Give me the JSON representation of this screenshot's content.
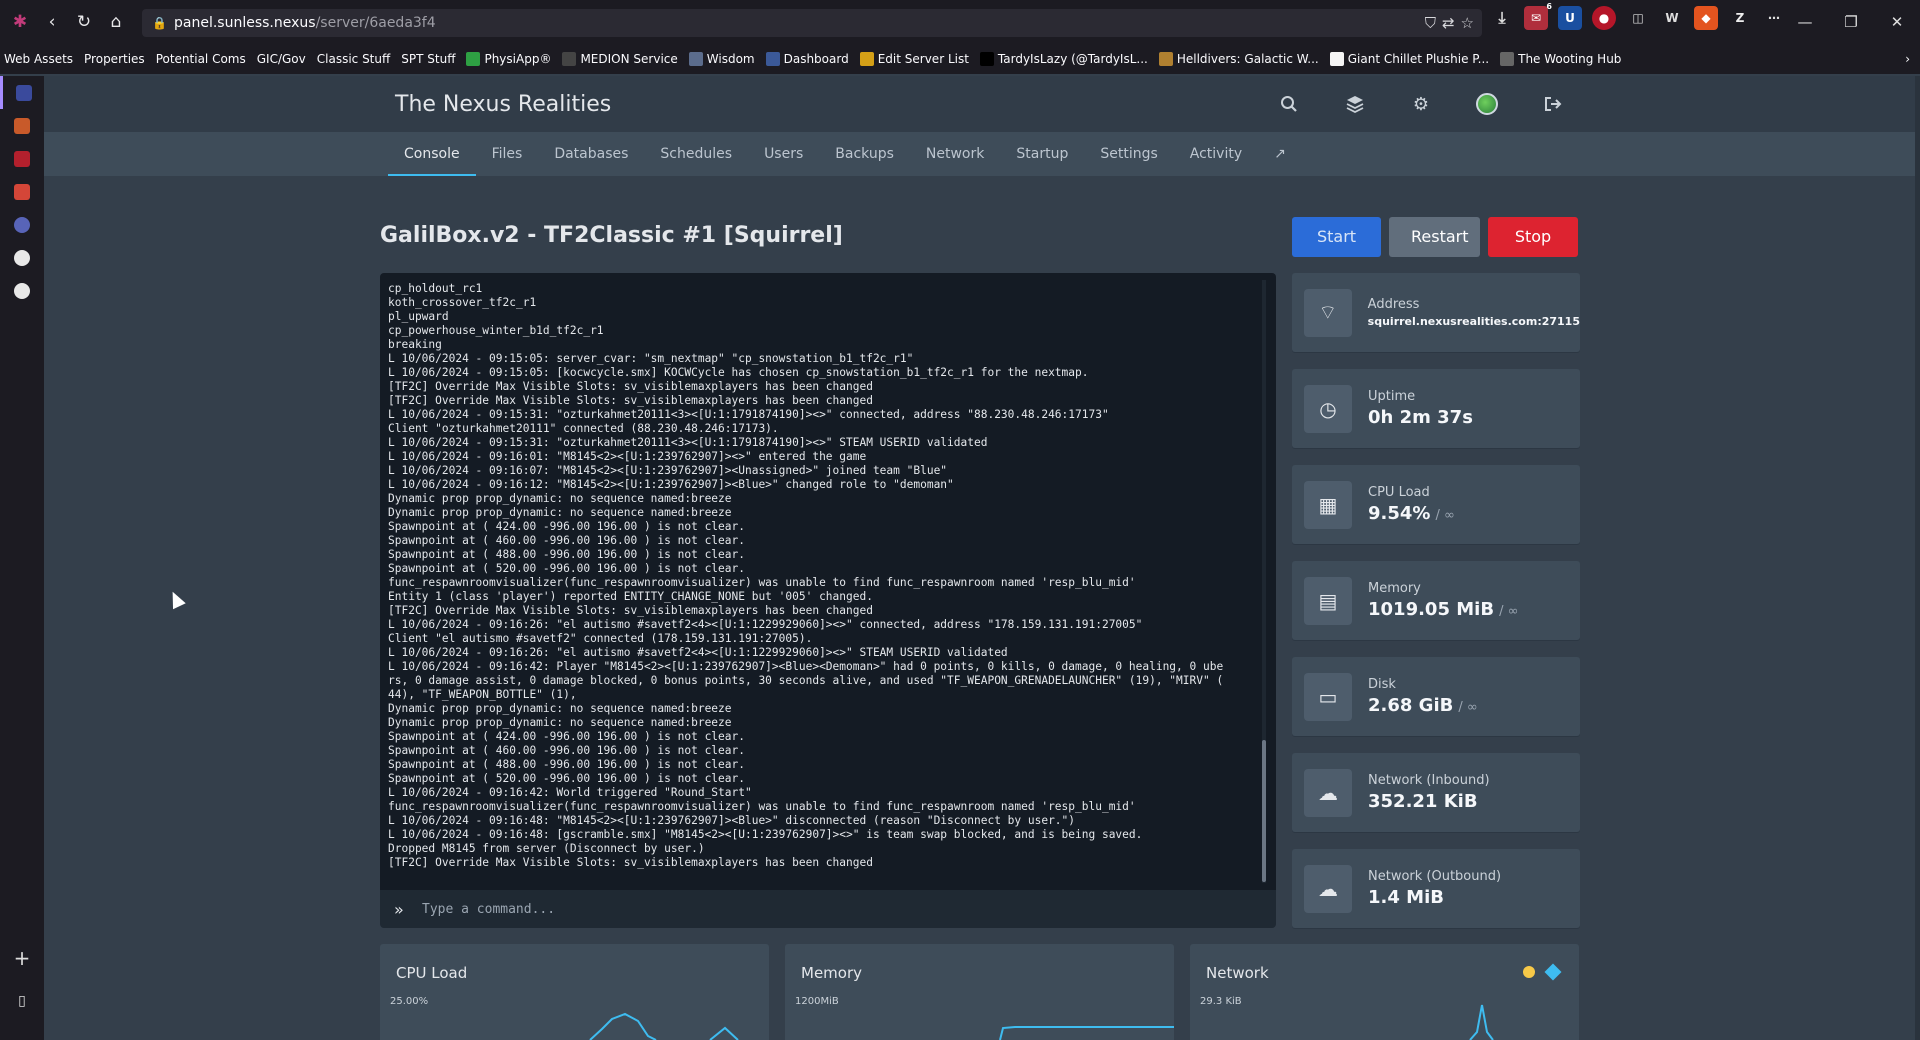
{
  "browser": {
    "url_host": "panel.sunless.nexus",
    "url_path": "/server/6aeda3f4",
    "bookmarks": [
      "Web Assets",
      "Properties",
      "Potential Coms",
      "GIC/Gov",
      "Classic Stuff",
      "SPT Stuff",
      "PhysiApp®",
      "MEDION Service",
      "Wisdom",
      "Dashboard",
      "Edit Server List",
      "TardyIsLazy (@TardyIsL...",
      "Helldivers: Galactic W...",
      "Giant Chillet Plushie P...",
      "The Wooting Hub"
    ],
    "download_badge": "6"
  },
  "panel": {
    "title": "The Nexus Realities",
    "tabs": [
      "Console",
      "Files",
      "Databases",
      "Schedules",
      "Users",
      "Backups",
      "Network",
      "Startup",
      "Settings",
      "Activity"
    ]
  },
  "server": {
    "name": "GalilBox.v2 - TF2Classic #1 [Squirrel]",
    "start_label": "Start",
    "restart_label": "Restart",
    "stop_label": "Stop"
  },
  "console": {
    "lines": [
      "cp_holdout_rc1",
      "koth_crossover_tf2c_r1",
      "pl_upward",
      "cp_powerhouse_winter_b1d_tf2c_r1",
      "breaking",
      "L 10/06/2024 - 09:15:05: server_cvar: \"sm_nextmap\" \"cp_snowstation_b1_tf2c_r1\"",
      "L 10/06/2024 - 09:15:05: [kocwcycle.smx] KOCWCycle has chosen cp_snowstation_b1_tf2c_r1 for the nextmap.",
      "[TF2C] Override Max Visible Slots: sv_visiblemaxplayers has been changed",
      "[TF2C] Override Max Visible Slots: sv_visiblemaxplayers has been changed",
      "L 10/06/2024 - 09:15:31: \"ozturkahmet20111<3><[U:1:1791874190]><>\" connected, address \"88.230.48.246:17173\"",
      "Client \"ozturkahmet20111\" connected (88.230.48.246:17173).",
      "L 10/06/2024 - 09:15:31: \"ozturkahmet20111<3><[U:1:1791874190]><>\" STEAM USERID validated",
      "L 10/06/2024 - 09:16:01: \"M8145<2><[U:1:239762907]><>\" entered the game",
      "L 10/06/2024 - 09:16:07: \"M8145<2><[U:1:239762907]><Unassigned>\" joined team \"Blue\"",
      "L 10/06/2024 - 09:16:12: \"M8145<2><[U:1:239762907]><Blue>\" changed role to \"demoman\"",
      "Dynamic prop prop_dynamic: no sequence named:breeze",
      "Dynamic prop prop_dynamic: no sequence named:breeze",
      "Spawnpoint at ( 424.00 -996.00 196.00 ) is not clear.",
      "Spawnpoint at ( 460.00 -996.00 196.00 ) is not clear.",
      "Spawnpoint at ( 488.00 -996.00 196.00 ) is not clear.",
      "Spawnpoint at ( 520.00 -996.00 196.00 ) is not clear.",
      "func_respawnroomvisualizer(func_respawnroomvisualizer) was unable to find func_respawnroom named 'resp_blu_mid'",
      "Entity 1 (class 'player') reported ENTITY_CHANGE_NONE but '005' changed.",
      "[TF2C] Override Max Visible Slots: sv_visiblemaxplayers has been changed",
      "L 10/06/2024 - 09:16:26: \"el autismo #savetf2<4><[U:1:1229929060]><>\" connected, address \"178.159.131.191:27005\"",
      "Client \"el autismo #savetf2\" connected (178.159.131.191:27005).",
      "L 10/06/2024 - 09:16:26: \"el autismo #savetf2<4><[U:1:1229929060]><>\" STEAM USERID validated",
      "L 10/06/2024 - 09:16:42: Player \"M8145<2><[U:1:239762907]><Blue><Demoman>\" had 0 points, 0 kills, 0 damage, 0 healing, 0 ube",
      "rs, 0 damage assist, 0 damage blocked, 0 bonus points, 30 seconds alive, and used \"TF_WEAPON_GRENADELAUNCHER\" (19), \"MIRV\" (",
      "44), \"TF_WEAPON_BOTTLE\" (1),",
      "Dynamic prop prop_dynamic: no sequence named:breeze",
      "Dynamic prop prop_dynamic: no sequence named:breeze",
      "Spawnpoint at ( 424.00 -996.00 196.00 ) is not clear.",
      "Spawnpoint at ( 460.00 -996.00 196.00 ) is not clear.",
      "Spawnpoint at ( 488.00 -996.00 196.00 ) is not clear.",
      "Spawnpoint at ( 520.00 -996.00 196.00 ) is not clear.",
      "L 10/06/2024 - 09:16:42: World triggered \"Round_Start\"",
      "func_respawnroomvisualizer(func_respawnroomvisualizer) was unable to find func_respawnroom named 'resp_blu_mid'",
      "L 10/06/2024 - 09:16:48: \"M8145<2><[U:1:239762907]><Blue>\" disconnected (reason \"Disconnect by user.\")",
      "L 10/06/2024 - 09:16:48: [gscramble.smx] \"M8145<2><[U:1:239762907]><>\" is team swap blocked, and is being saved.",
      "Dropped M8145 from server (Disconnect by user.)",
      "[TF2C] Override Max Visible Slots: sv_visiblemaxplayers has been changed"
    ],
    "command_placeholder": "Type a command..."
  },
  "stats": [
    {
      "label": "Address",
      "value": "squirrel.nexusrealities.com:27115",
      "limit": "",
      "icon": "wifi-icon"
    },
    {
      "label": "Uptime",
      "value": "0h 2m 37s",
      "limit": "",
      "icon": "clock-icon"
    },
    {
      "label": "CPU Load",
      "value": "9.54%",
      "limit": "/ ∞",
      "icon": "cpu-icon"
    },
    {
      "label": "Memory",
      "value": "1019.05 MiB",
      "limit": "/ ∞",
      "icon": "memory-icon"
    },
    {
      "label": "Disk",
      "value": "2.68 GiB",
      "limit": "/ ∞",
      "icon": "disk-icon"
    },
    {
      "label": "Network (Inbound)",
      "value": "352.21 KiB",
      "limit": "",
      "icon": "cloud-download-icon"
    },
    {
      "label": "Network (Outbound)",
      "value": "1.4 MiB",
      "limit": "",
      "icon": "cloud-upload-icon"
    }
  ],
  "graphs": [
    {
      "title": "CPU Load",
      "axis_top": "25.00%"
    },
    {
      "title": "Memory",
      "axis_top": "1200MiB"
    },
    {
      "title": "Network",
      "axis_top": "29.3 KiB"
    }
  ],
  "colors": {
    "accent": "#3ebcf0",
    "start": "#2b6cd8",
    "restart": "#616e7c",
    "stop": "#dd2330"
  }
}
